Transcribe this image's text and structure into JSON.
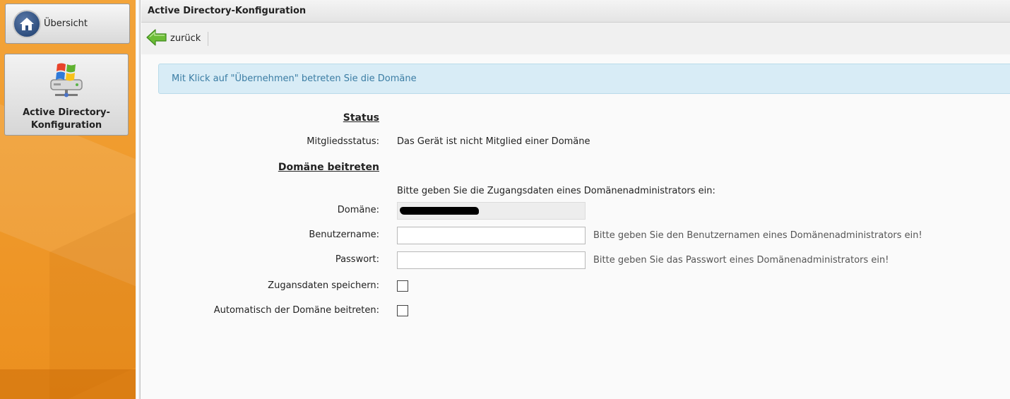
{
  "sidebar": {
    "overview_label": "Übersicht",
    "active_item_label": "Active Directory-\nKonfiguration"
  },
  "header": {
    "title": "Active Directory-Konfiguration"
  },
  "toolbar": {
    "back_label": "zurück"
  },
  "info": {
    "message": "Mit Klick auf \"Übernehmen\" betreten Sie die Domäne"
  },
  "status": {
    "section_title": "Status",
    "membership_label": "Mitgliedsstatus:",
    "membership_value": "Das Gerät ist nicht Mitglied einer Domäne"
  },
  "join": {
    "section_title": "Domäne beitreten",
    "intro": "Bitte geben Sie die Zugangsdaten eines Domänenadministrators ein:",
    "domain_label": "Domäne:",
    "domain_value": "",
    "username_label": "Benutzername:",
    "username_value": "",
    "username_hint": "Bitte geben Sie den Benutzernamen eines Domänenadministrators ein!",
    "password_label": "Passwort:",
    "password_value": "",
    "password_hint": "Bitte geben Sie das Passwort eines Domänenadministrators ein!",
    "save_credentials_label": "Zugansdaten speichern:",
    "auto_join_label": "Automatisch der Domäne beitreten:"
  },
  "colors": {
    "sidebar_orange": "#ef9a2c",
    "info_bg": "#d8ecf6",
    "info_text": "#3b7da4",
    "back_arrow_green": "#5fb12f"
  },
  "icons": {
    "overview": "home-icon",
    "active_item": "windows-server-icon",
    "back": "arrow-left-icon"
  }
}
